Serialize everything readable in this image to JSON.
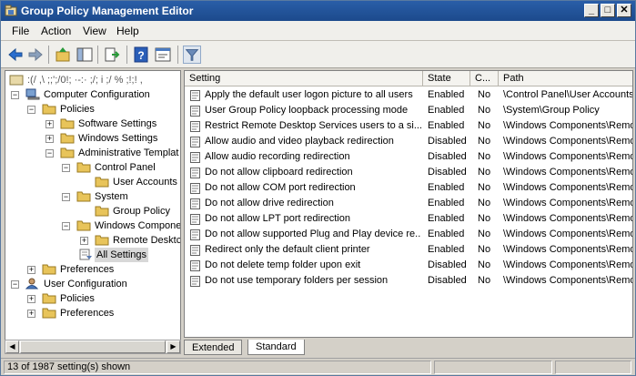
{
  "window": {
    "title": "Group Policy Management Editor",
    "controls": {
      "minimize": "_",
      "maximize": "□",
      "close": "✕"
    }
  },
  "menu": {
    "file": "File",
    "action": "Action",
    "view": "View",
    "help": "Help"
  },
  "toolbar": {
    "icons": [
      "back-icon",
      "forward-icon",
      "up-folder-icon",
      "show-hide-tree-icon",
      "export-list-icon",
      "help-icon",
      "properties-icon",
      "filter-icon"
    ]
  },
  "tree": {
    "root": ":(/ ,\\ ;;';/0!; ·-:·  ;/; i ;/ %  ;!;! ,",
    "computer_configuration": "Computer Configuration",
    "policies": "Policies",
    "software_settings": "Software Settings",
    "windows_settings": "Windows Settings",
    "administrative_templates": "Administrative Templat",
    "control_panel": "Control Panel",
    "user_accounts": "User Accounts",
    "system": "System",
    "group_policy": "Group Policy",
    "windows_components": "Windows Compone",
    "remote_desktop": "Remote Desktc",
    "all_settings": "All Settings",
    "preferences": "Preferences",
    "user_configuration": "User Configuration",
    "user_policies": "Policies",
    "user_preferences": "Preferences",
    "expander_plus": "+",
    "expander_minus": "−"
  },
  "columns": {
    "setting": "Setting",
    "state": "State",
    "comment": "C...",
    "path": "Path"
  },
  "rows": [
    {
      "setting": "Apply the default user logon picture to all users",
      "state": "Enabled",
      "comment": "No",
      "path": "\\Control Panel\\User Accounts"
    },
    {
      "setting": "User Group Policy loopback processing mode",
      "state": "Enabled",
      "comment": "No",
      "path": "\\System\\Group Policy"
    },
    {
      "setting": "Restrict Remote Desktop Services users to a si...",
      "state": "Enabled",
      "comment": "No",
      "path": "\\Windows Components\\Remo"
    },
    {
      "setting": "Allow audio and video playback redirection",
      "state": "Disabled",
      "comment": "No",
      "path": "\\Windows Components\\Remo"
    },
    {
      "setting": "Allow audio recording redirection",
      "state": "Disabled",
      "comment": "No",
      "path": "\\Windows Components\\Remo"
    },
    {
      "setting": "Do not allow clipboard redirection",
      "state": "Disabled",
      "comment": "No",
      "path": "\\Windows Components\\Remo"
    },
    {
      "setting": "Do not allow COM port redirection",
      "state": "Enabled",
      "comment": "No",
      "path": "\\Windows Components\\Remo"
    },
    {
      "setting": "Do not allow drive redirection",
      "state": "Enabled",
      "comment": "No",
      "path": "\\Windows Components\\Remo"
    },
    {
      "setting": "Do not allow LPT port redirection",
      "state": "Enabled",
      "comment": "No",
      "path": "\\Windows Components\\Remo"
    },
    {
      "setting": "Do not allow supported Plug and Play device re...",
      "state": "Enabled",
      "comment": "No",
      "path": "\\Windows Components\\Remo"
    },
    {
      "setting": "Redirect only the default client printer",
      "state": "Enabled",
      "comment": "No",
      "path": "\\Windows Components\\Remo"
    },
    {
      "setting": "Do not delete temp folder upon exit",
      "state": "Disabled",
      "comment": "No",
      "path": "\\Windows Components\\Remo"
    },
    {
      "setting": "Do not use temporary folders per session",
      "state": "Disabled",
      "comment": "No",
      "path": "\\Windows Components\\Remo"
    }
  ],
  "tabs": {
    "extended": "Extended",
    "standard": "Standard",
    "active": "Standard"
  },
  "status": {
    "text": "13 of 1987 setting(s) shown"
  },
  "scroll": {
    "left_arrow": "◀",
    "right_arrow": "▶"
  },
  "colors": {
    "titlebar": "#1c4a8c",
    "folder": "#e8c45a",
    "window_bg": "#d4d0c8"
  }
}
